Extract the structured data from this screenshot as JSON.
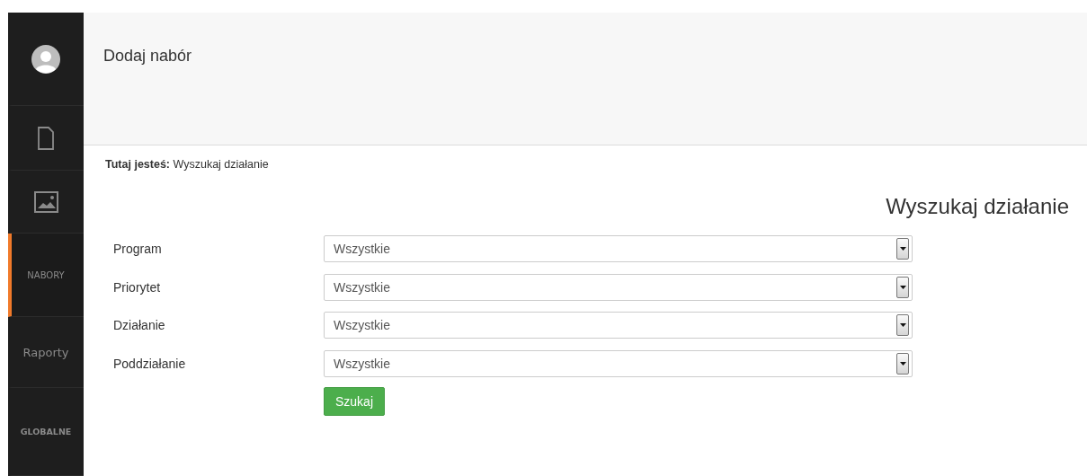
{
  "sidebar": {
    "items": [
      {
        "kind": "avatar",
        "selected": false
      },
      {
        "kind": "document",
        "selected": false
      },
      {
        "kind": "image",
        "selected": false
      },
      {
        "kind": "caption",
        "label": "NABORY",
        "selected": true
      },
      {
        "kind": "label",
        "label": "Raporty",
        "selected": false
      },
      {
        "kind": "bold-caption",
        "label": "GLOBALNE",
        "selected": false
      }
    ]
  },
  "header": {
    "title": "Dodaj nabór"
  },
  "breadcrumb": "**Tutaj jesteś:** Wyszukaj działanie",
  "heading": "Wyszukaj działanie",
  "form": {
    "fields": [
      {
        "label": "Program",
        "value": "Wszystkie"
      },
      {
        "label": "Priorytet",
        "value": "Wszystkie"
      },
      {
        "label": "Działanie",
        "value": "Wszystkie"
      },
      {
        "label": "Poddziałanie",
        "value": "Wszystkie"
      }
    ],
    "submit": "Szukaj"
  }
}
